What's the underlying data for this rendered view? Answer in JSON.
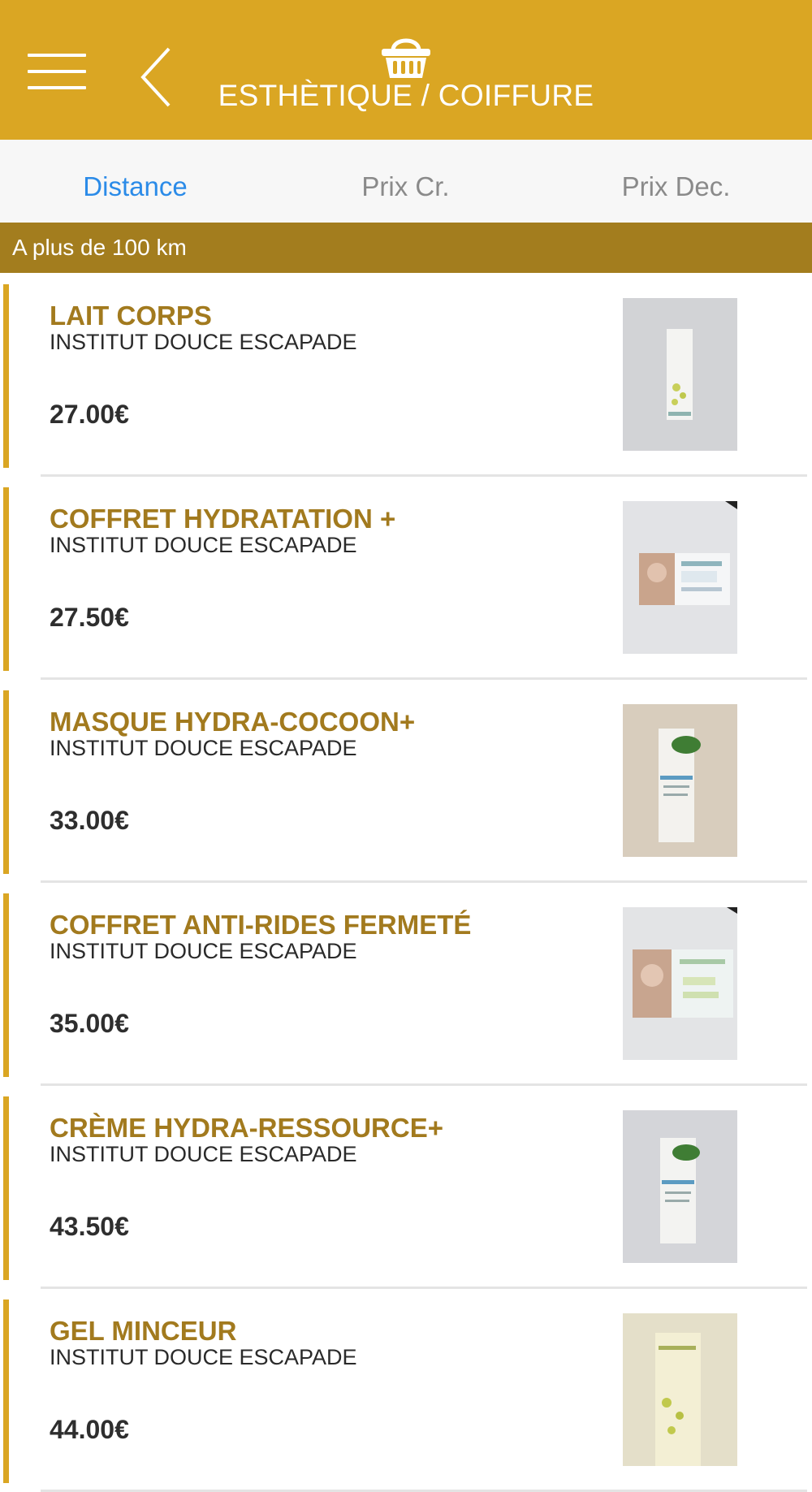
{
  "header": {
    "title": "ESTHÈTIQUE / COIFFURE",
    "menu_icon": "hamburger-menu-icon",
    "back_icon": "chevron-left-icon",
    "basket_icon": "shopping-basket-icon"
  },
  "tabs": [
    {
      "label": "Distance",
      "active": true
    },
    {
      "label": "Prix Cr.",
      "active": false
    },
    {
      "label": "Prix Dec.",
      "active": false
    }
  ],
  "section": {
    "label": "A plus de 100 km"
  },
  "products": [
    {
      "title": "LAIT CORPS",
      "shop": "INSTITUT DOUCE ESCAPADE",
      "price": "27.00€"
    },
    {
      "title": "COFFRET HYDRATATION +",
      "shop": "INSTITUT DOUCE ESCAPADE",
      "price": "27.50€"
    },
    {
      "title": "MASQUE HYDRA-COCOON+",
      "shop": "INSTITUT DOUCE ESCAPADE",
      "price": "33.00€"
    },
    {
      "title": "COFFRET ANTI-RIDES FERMETÉ",
      "shop": "INSTITUT DOUCE ESCAPADE",
      "price": "35.00€"
    },
    {
      "title": "CRÈME HYDRA-RESSOURCE+",
      "shop": "INSTITUT DOUCE ESCAPADE",
      "price": "43.50€"
    },
    {
      "title": "GEL MINCEUR",
      "shop": "INSTITUT DOUCE ESCAPADE",
      "price": "44.00€"
    }
  ],
  "colors": {
    "header_bg": "#DAA623",
    "section_bg": "#A37D1E",
    "title_color": "#A27A1E",
    "active_tab": "#2B8BE8"
  }
}
